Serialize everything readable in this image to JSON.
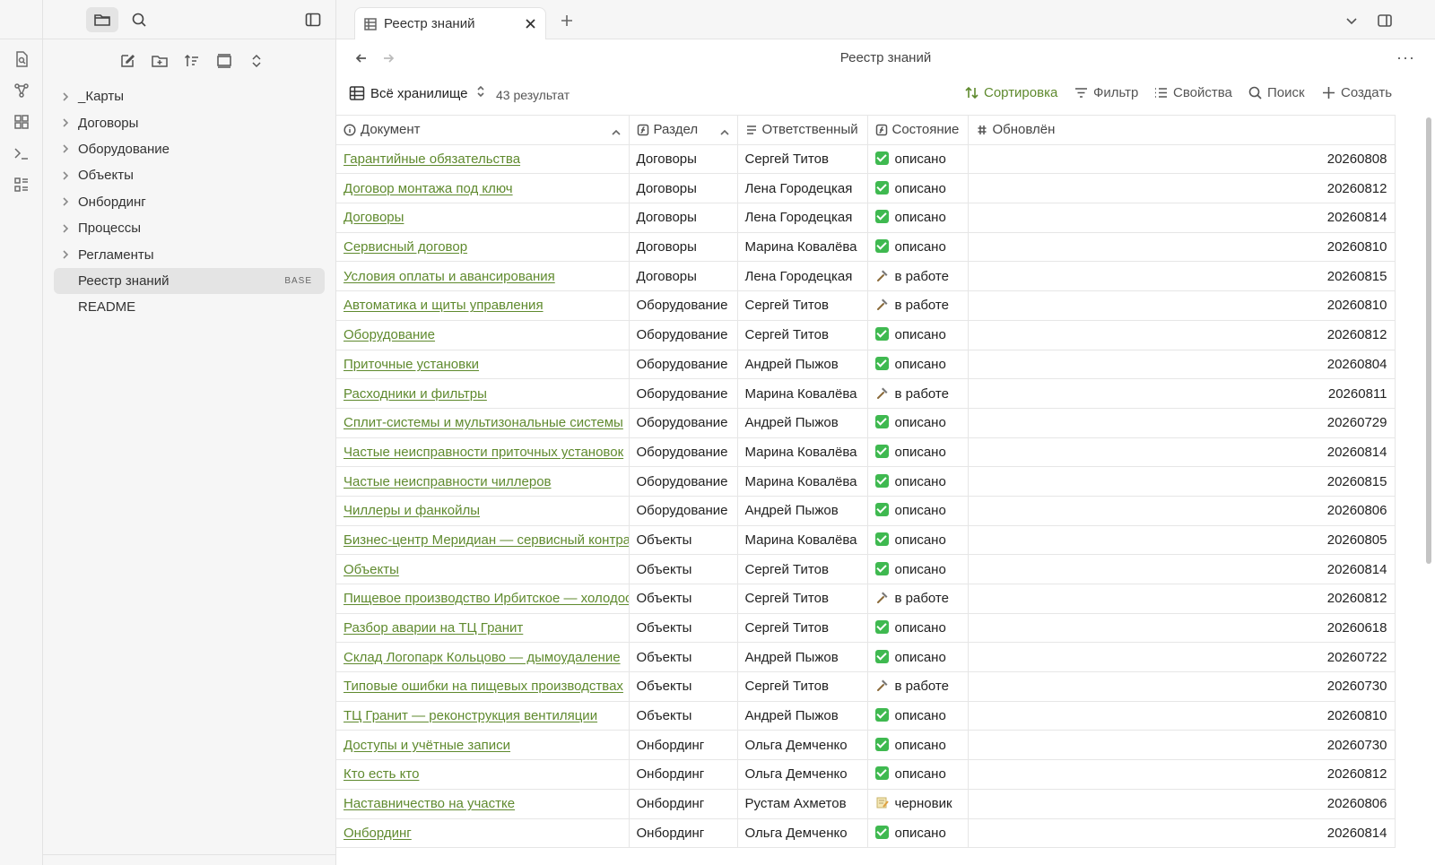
{
  "ribbon": {
    "icons": [
      "search-in-file-icon",
      "graph-view-icon",
      "canvas-icon",
      "terminal-icon",
      "bases-icon"
    ]
  },
  "sidebar": {
    "tabs": [
      "files-icon",
      "search-icon"
    ],
    "actions": [
      "new-note-icon",
      "new-folder-icon",
      "sort-icon",
      "layout-icon",
      "expand-collapse-icon"
    ],
    "items": [
      {
        "label": "_Карты",
        "type": "folder"
      },
      {
        "label": "Договоры",
        "type": "folder"
      },
      {
        "label": "Оборудование",
        "type": "folder"
      },
      {
        "label": "Объекты",
        "type": "folder"
      },
      {
        "label": "Онбординг",
        "type": "folder"
      },
      {
        "label": "Процессы",
        "type": "folder"
      },
      {
        "label": "Регламенты",
        "type": "folder"
      },
      {
        "label": "Реестр знаний",
        "type": "file",
        "badge": "BASE",
        "active": true
      },
      {
        "label": "README",
        "type": "file"
      }
    ]
  },
  "tabbar": {
    "active_tab": "Реестр знаний"
  },
  "navbar": {
    "title": "Реестр знаний"
  },
  "toolbar": {
    "view_name": "Всё хранилище",
    "result_count": "43 результат",
    "sort_label": "Сортировка",
    "filter_label": "Фильтр",
    "properties_label": "Свойства",
    "search_label": "Поиск",
    "create_label": "Создать",
    "accent_color": "#5f8a2e"
  },
  "table": {
    "columns": [
      "Документ",
      "Раздел",
      "Ответственный",
      "Состояние",
      "Обновлён"
    ],
    "rows": [
      [
        "Гарантийные обязательства",
        "Договоры",
        "Сергей Титов",
        "done",
        "описано",
        "20260808"
      ],
      [
        "Договор монтажа под ключ",
        "Договоры",
        "Лена Городецкая",
        "done",
        "описано",
        "20260812"
      ],
      [
        "Договоры",
        "Договоры",
        "Лена Городецкая",
        "done",
        "описано",
        "20260814"
      ],
      [
        "Сервисный договор",
        "Договоры",
        "Марина Ковалёва",
        "done",
        "описано",
        "20260810"
      ],
      [
        "Условия оплаты и авансирования",
        "Договоры",
        "Лена Городецкая",
        "work",
        "в работе",
        "20260815"
      ],
      [
        "Автоматика и щиты управления",
        "Оборудование",
        "Сергей Титов",
        "work",
        "в работе",
        "20260810"
      ],
      [
        "Оборудование",
        "Оборудование",
        "Сергей Титов",
        "done",
        "описано",
        "20260812"
      ],
      [
        "Приточные установки",
        "Оборудование",
        "Андрей Пыжов",
        "done",
        "описано",
        "20260804"
      ],
      [
        "Расходники и фильтры",
        "Оборудование",
        "Марина Ковалёва",
        "work",
        "в работе",
        "20260811"
      ],
      [
        "Сплит-системы и мультизональные системы",
        "Оборудование",
        "Андрей Пыжов",
        "done",
        "описано",
        "20260729"
      ],
      [
        "Частые неисправности приточных установок",
        "Оборудование",
        "Марина Ковалёва",
        "done",
        "описано",
        "20260814"
      ],
      [
        "Частые неисправности чиллеров",
        "Оборудование",
        "Марина Ковалёва",
        "done",
        "описано",
        "20260815"
      ],
      [
        "Чиллеры и фанкойлы",
        "Оборудование",
        "Андрей Пыжов",
        "done",
        "описано",
        "20260806"
      ],
      [
        "Бизнес-центр Меридиан — сервисный контракт",
        "Объекты",
        "Марина Ковалёва",
        "done",
        "описано",
        "20260805"
      ],
      [
        "Объекты",
        "Объекты",
        "Сергей Титов",
        "done",
        "описано",
        "20260814"
      ],
      [
        "Пищевое производство Ирбитское — холодоснабжение",
        "Объекты",
        "Сергей Титов",
        "work",
        "в работе",
        "20260812"
      ],
      [
        "Разбор аварии на ТЦ Гранит",
        "Объекты",
        "Сергей Титов",
        "done",
        "описано",
        "20260618"
      ],
      [
        "Склад Логопарк Кольцово — дымоудаление",
        "Объекты",
        "Андрей Пыжов",
        "done",
        "описано",
        "20260722"
      ],
      [
        "Типовые ошибки на пищевых производствах",
        "Объекты",
        "Сергей Титов",
        "work",
        "в работе",
        "20260730"
      ],
      [
        "ТЦ Гранит — реконструкция вентиляции",
        "Объекты",
        "Андрей Пыжов",
        "done",
        "описано",
        "20260810"
      ],
      [
        "Доступы и учётные записи",
        "Онбординг",
        "Ольга Демченко",
        "done",
        "описано",
        "20260730"
      ],
      [
        "Кто есть кто",
        "Онбординг",
        "Ольга Демченко",
        "done",
        "описано",
        "20260812"
      ],
      [
        "Наставничество на участке",
        "Онбординг",
        "Рустам Ахметов",
        "draft",
        "черновик",
        "20260806"
      ],
      [
        "Онбординг",
        "Онбординг",
        "Ольга Демченко",
        "done",
        "описано",
        "20260814"
      ]
    ]
  }
}
